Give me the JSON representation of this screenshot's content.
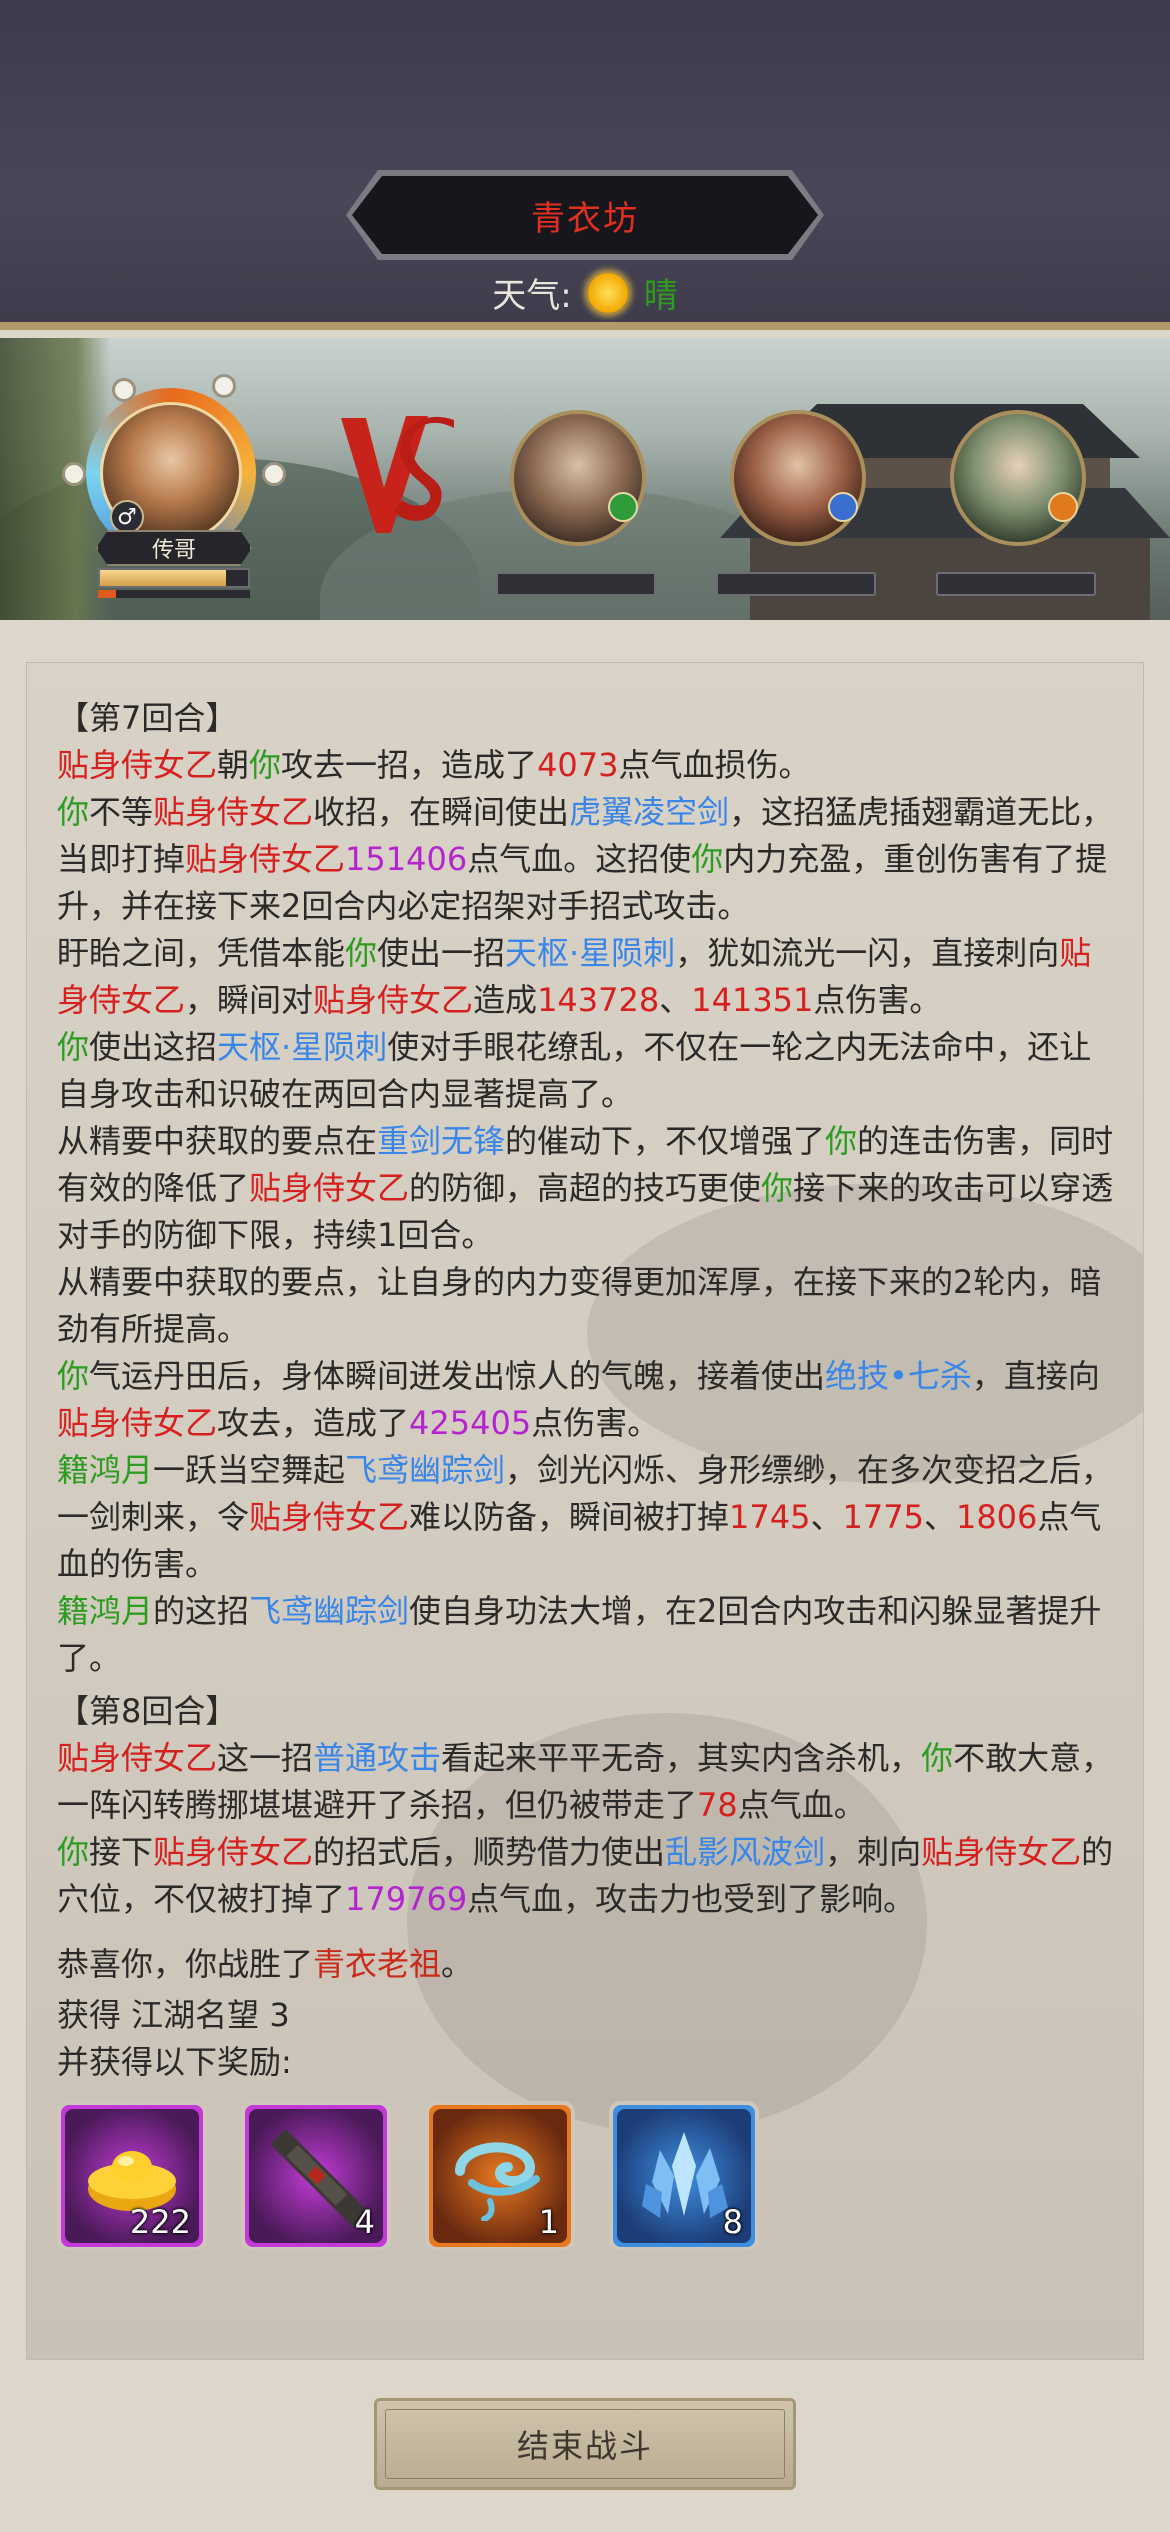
{
  "header": {
    "title": "青衣坊",
    "weather_label": "天气:",
    "weather_icon": "sun-icon",
    "weather_value": "晴"
  },
  "battle": {
    "player": {
      "name": "传哥",
      "gender_symbol": "♂",
      "hp_fraction": 0.85,
      "energy_fraction": 0.12
    },
    "vs_icon": "vs-icon",
    "enemies": [
      {
        "badge_color": "#2f9c3a"
      },
      {
        "badge_color": "#3a6fd0"
      },
      {
        "badge_color": "#e07a1c"
      }
    ]
  },
  "log": {
    "round7": "【第7回合】",
    "round8": "【第8回合】",
    "names": {
      "maid": "贴身侍女乙",
      "you": "你",
      "ji": "籍鸿月",
      "boss": "青衣老祖"
    },
    "skills": {
      "huyi": "虎翼凌空剑",
      "tianshu": "天枢·星陨刺",
      "zhongjian": "重剑无锋",
      "jueji": "绝技•七杀",
      "feiyuan": "飞鸢幽踪剑",
      "putong": "普通攻击",
      "luanying": "乱影风波剑"
    },
    "nums": {
      "n4073": "4073",
      "n151406": "151406",
      "n143728": "143728",
      "n141351": "141351",
      "n425405": "425405",
      "n1745": "1745",
      "n1775": "1775",
      "n1806": "1806",
      "n78": "78",
      "n179769": "179769"
    },
    "t": {
      "a1": "朝",
      "a2": "攻去一招，造成了",
      "a3": "点气血损伤。",
      "b1": "不等",
      "b2": "收招，在瞬间使出",
      "b3": "，这招猛虎插翅霸道无比，当即打掉",
      "b4": "点气血。这招使",
      "b5": "内力充盈，重创伤害有了提升，并在接下来2回合内必定招架对手招式攻击。",
      "c1": "盱眙之间，凭借本能",
      "c2": "使出一招",
      "c3": "，犹如流光一闪，直接刺向",
      "c4": "，瞬间对",
      "c5": "造成",
      "c6": "、",
      "c7": "点伤害。",
      "d1": "使出这招",
      "d2": "使对手眼花缭乱，不仅在一轮之内无法命中，还让自身攻击和识破在两回合内显著提高了。",
      "e1": "从精要中获取的要点在",
      "e2": "的催动下，不仅增强了",
      "e3": "的连击伤害，同时有效的降低了",
      "e4": "的防御，高超的技巧更使",
      "e5": "接下来的攻击可以穿透对手的防御下限，持续1回合。",
      "f1": "从精要中获取的要点，让自身的内力变得更加浑厚，在接下来的2轮内，暗劲有所提高。",
      "g1": "气运丹田后，身体瞬间迸发出惊人的气魄，接着使出",
      "g2": "，直接向",
      "g3": "攻去，造成了",
      "g4": "点伤害。",
      "h1": "一跃当空舞起",
      "h2": "，剑光闪烁、身形缥缈，在多次变招之后，一剑刺来，令",
      "h3": "难以防备，瞬间被打掉",
      "h4": "、",
      "h5": "、",
      "h6": "点气血的伤害。",
      "i1": "的这招",
      "i2": "使自身功法大增，在2回合内攻击和闪躲显著提升了。",
      "j1": "这一招",
      "j2": "看起来平平无奇，其实内含杀机，",
      "j3": "不敢大意，一阵闪转腾挪堪堪避开了杀招，但仍被带走了",
      "j4": "点气血。",
      "k1": "接下",
      "k2": "的招式后，顺势借力使出",
      "k3": "，刺向",
      "k4": "的穴位，不仅被打掉了",
      "k5": "点气血，攻击力也受到了影响。",
      "win1": "恭喜你，你战胜了",
      "win2": "。",
      "fame": "获得 江湖名望 3",
      "rewards_label": "并获得以下奖励:"
    }
  },
  "rewards": [
    {
      "icon": "gold-ingot-icon",
      "count": "222",
      "frame": "#c23bd6",
      "bg": "#4a1a58"
    },
    {
      "icon": "scroll-case-icon",
      "count": "4",
      "frame": "#c23bd6",
      "bg": "#4a1a58"
    },
    {
      "icon": "cloud-swirl-icon",
      "count": "1",
      "frame": "#e8791f",
      "bg": "#6a2a10"
    },
    {
      "icon": "crystal-cluster-icon",
      "count": "8",
      "frame": "#3f8fe0",
      "bg": "#1d3d78"
    }
  ],
  "footer": {
    "end_button": "结束战斗"
  }
}
